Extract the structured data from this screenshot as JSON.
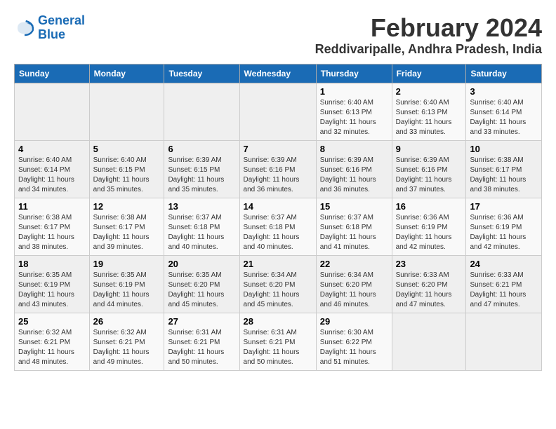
{
  "logo": {
    "line1": "General",
    "line2": "Blue"
  },
  "title": "February 2024",
  "location": "Reddivaripalle, Andhra Pradesh, India",
  "headers": [
    "Sunday",
    "Monday",
    "Tuesday",
    "Wednesday",
    "Thursday",
    "Friday",
    "Saturday"
  ],
  "weeks": [
    [
      {
        "day": "",
        "info": ""
      },
      {
        "day": "",
        "info": ""
      },
      {
        "day": "",
        "info": ""
      },
      {
        "day": "",
        "info": ""
      },
      {
        "day": "1",
        "info": "Sunrise: 6:40 AM\nSunset: 6:13 PM\nDaylight: 11 hours\nand 32 minutes."
      },
      {
        "day": "2",
        "info": "Sunrise: 6:40 AM\nSunset: 6:13 PM\nDaylight: 11 hours\nand 33 minutes."
      },
      {
        "day": "3",
        "info": "Sunrise: 6:40 AM\nSunset: 6:14 PM\nDaylight: 11 hours\nand 33 minutes."
      }
    ],
    [
      {
        "day": "4",
        "info": "Sunrise: 6:40 AM\nSunset: 6:14 PM\nDaylight: 11 hours\nand 34 minutes."
      },
      {
        "day": "5",
        "info": "Sunrise: 6:40 AM\nSunset: 6:15 PM\nDaylight: 11 hours\nand 35 minutes."
      },
      {
        "day": "6",
        "info": "Sunrise: 6:39 AM\nSunset: 6:15 PM\nDaylight: 11 hours\nand 35 minutes."
      },
      {
        "day": "7",
        "info": "Sunrise: 6:39 AM\nSunset: 6:16 PM\nDaylight: 11 hours\nand 36 minutes."
      },
      {
        "day": "8",
        "info": "Sunrise: 6:39 AM\nSunset: 6:16 PM\nDaylight: 11 hours\nand 36 minutes."
      },
      {
        "day": "9",
        "info": "Sunrise: 6:39 AM\nSunset: 6:16 PM\nDaylight: 11 hours\nand 37 minutes."
      },
      {
        "day": "10",
        "info": "Sunrise: 6:38 AM\nSunset: 6:17 PM\nDaylight: 11 hours\nand 38 minutes."
      }
    ],
    [
      {
        "day": "11",
        "info": "Sunrise: 6:38 AM\nSunset: 6:17 PM\nDaylight: 11 hours\nand 38 minutes."
      },
      {
        "day": "12",
        "info": "Sunrise: 6:38 AM\nSunset: 6:17 PM\nDaylight: 11 hours\nand 39 minutes."
      },
      {
        "day": "13",
        "info": "Sunrise: 6:37 AM\nSunset: 6:18 PM\nDaylight: 11 hours\nand 40 minutes."
      },
      {
        "day": "14",
        "info": "Sunrise: 6:37 AM\nSunset: 6:18 PM\nDaylight: 11 hours\nand 40 minutes."
      },
      {
        "day": "15",
        "info": "Sunrise: 6:37 AM\nSunset: 6:18 PM\nDaylight: 11 hours\nand 41 minutes."
      },
      {
        "day": "16",
        "info": "Sunrise: 6:36 AM\nSunset: 6:19 PM\nDaylight: 11 hours\nand 42 minutes."
      },
      {
        "day": "17",
        "info": "Sunrise: 6:36 AM\nSunset: 6:19 PM\nDaylight: 11 hours\nand 42 minutes."
      }
    ],
    [
      {
        "day": "18",
        "info": "Sunrise: 6:35 AM\nSunset: 6:19 PM\nDaylight: 11 hours\nand 43 minutes."
      },
      {
        "day": "19",
        "info": "Sunrise: 6:35 AM\nSunset: 6:19 PM\nDaylight: 11 hours\nand 44 minutes."
      },
      {
        "day": "20",
        "info": "Sunrise: 6:35 AM\nSunset: 6:20 PM\nDaylight: 11 hours\nand 45 minutes."
      },
      {
        "day": "21",
        "info": "Sunrise: 6:34 AM\nSunset: 6:20 PM\nDaylight: 11 hours\nand 45 minutes."
      },
      {
        "day": "22",
        "info": "Sunrise: 6:34 AM\nSunset: 6:20 PM\nDaylight: 11 hours\nand 46 minutes."
      },
      {
        "day": "23",
        "info": "Sunrise: 6:33 AM\nSunset: 6:20 PM\nDaylight: 11 hours\nand 47 minutes."
      },
      {
        "day": "24",
        "info": "Sunrise: 6:33 AM\nSunset: 6:21 PM\nDaylight: 11 hours\nand 47 minutes."
      }
    ],
    [
      {
        "day": "25",
        "info": "Sunrise: 6:32 AM\nSunset: 6:21 PM\nDaylight: 11 hours\nand 48 minutes."
      },
      {
        "day": "26",
        "info": "Sunrise: 6:32 AM\nSunset: 6:21 PM\nDaylight: 11 hours\nand 49 minutes."
      },
      {
        "day": "27",
        "info": "Sunrise: 6:31 AM\nSunset: 6:21 PM\nDaylight: 11 hours\nand 50 minutes."
      },
      {
        "day": "28",
        "info": "Sunrise: 6:31 AM\nSunset: 6:21 PM\nDaylight: 11 hours\nand 50 minutes."
      },
      {
        "day": "29",
        "info": "Sunrise: 6:30 AM\nSunset: 6:22 PM\nDaylight: 11 hours\nand 51 minutes."
      },
      {
        "day": "",
        "info": ""
      },
      {
        "day": "",
        "info": ""
      }
    ]
  ]
}
